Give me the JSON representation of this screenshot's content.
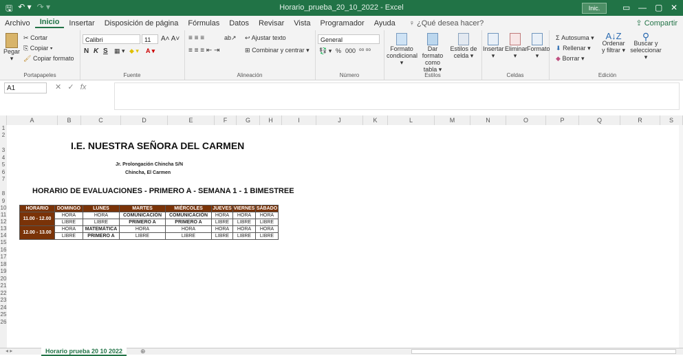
{
  "window": {
    "title": "Horario_prueba_20_10_2022  -  Excel",
    "signin": "Inic. ses.",
    "qat_save": "🖫",
    "qat_undo": "↶ ▾",
    "qat_redo": "↷ ▾"
  },
  "menu": [
    "Archivo",
    "Inicio",
    "Insertar",
    "Disposición de página",
    "Fórmulas",
    "Datos",
    "Revisar",
    "Vista",
    "Programador",
    "Ayuda"
  ],
  "tell_me": "¿Qué desea hacer?",
  "share": "Compartir",
  "ribbon": {
    "clipboard": {
      "label": "Portapapeles",
      "paste": "Pegar",
      "cut": "Cortar",
      "copy": "Copiar",
      "format_painter": "Copiar formato"
    },
    "font": {
      "label": "Fuente",
      "name": "Calibri",
      "size": "11",
      "bold": "N",
      "italic": "K",
      "underline": "S"
    },
    "alignment": {
      "label": "Alineación",
      "wrap": "Ajustar texto",
      "merge": "Combinar y centrar"
    },
    "number": {
      "label": "Número",
      "format": "General",
      "percent": "%",
      "thousands": "000"
    },
    "styles": {
      "label": "Estilos",
      "conditional": "Formato condicional",
      "as_table": "Dar formato como tabla",
      "cell_styles": "Estilos de celda"
    },
    "cells": {
      "label": "Celdas",
      "insert": "Insertar",
      "delete": "Eliminar",
      "format": "Formato"
    },
    "editing": {
      "label": "Edición",
      "autosum": "Autosuma",
      "fill": "Rellenar",
      "clear": "Borrar",
      "sort": "Ordenar y filtrar",
      "find": "Buscar y seleccionar"
    }
  },
  "formula_bar": {
    "name_box": "A1",
    "fx": "fx",
    "content": ""
  },
  "columns": [
    "A",
    "B",
    "C",
    "D",
    "E",
    "F",
    "G",
    "H",
    "I",
    "J",
    "K",
    "L",
    "M",
    "N",
    "O",
    "P",
    "Q",
    "R",
    "S"
  ],
  "rows": [
    "1",
    "2",
    "3",
    "4",
    "5",
    "6",
    "7",
    "8",
    "9",
    "10",
    "11",
    "12",
    "13",
    "14",
    "15",
    "16",
    "17",
    "18",
    "19",
    "20",
    "21",
    "22",
    "23",
    "24",
    "25",
    "26"
  ],
  "sheet": {
    "title": "I.E. NUESTRA SEÑORA DEL CARMEN",
    "address": "Jr. Prolongación Chincha S/N",
    "city": "Chincha, El Carmen",
    "heading": "HORARIO DE EVALUACIONES - PRIMERO A - SEMANA 1 - 1 BIMESTREE",
    "table_headers": [
      "HORARIO",
      "DOMINGO",
      "LUNES",
      "MARTES",
      "MIÉRCOLES",
      "JUEVES",
      "VIERNES",
      "SÁBADO"
    ],
    "rows": [
      {
        "hour": "11.00 - 12.00",
        "cells": [
          [
            "HORA",
            "LIBRE"
          ],
          [
            "HORA",
            "LIBRE"
          ],
          [
            "COMUNICACIÓN",
            "PRIMERO A"
          ],
          [
            "COMUNICACIÓN",
            "PRIMERO A"
          ],
          [
            "HORA",
            "LIBRE"
          ],
          [
            "HORA",
            "LIBRE"
          ],
          [
            "HORA",
            "LIBRE"
          ]
        ]
      },
      {
        "hour": "12.00 - 13.00",
        "cells": [
          [
            "HORA",
            "LIBRE"
          ],
          [
            "MATEMÁTICA",
            "PRIMERO A"
          ],
          [
            "HORA",
            "LIBRE"
          ],
          [
            "HORA",
            "LIBRE"
          ],
          [
            "HORA",
            "LIBRE"
          ],
          [
            "HORA",
            "LIBRE"
          ],
          [
            "HORA",
            "LIBRE"
          ]
        ]
      }
    ]
  },
  "sheet_tab": "Horario prueba 20 10 2022",
  "add_sheet": "⊕"
}
